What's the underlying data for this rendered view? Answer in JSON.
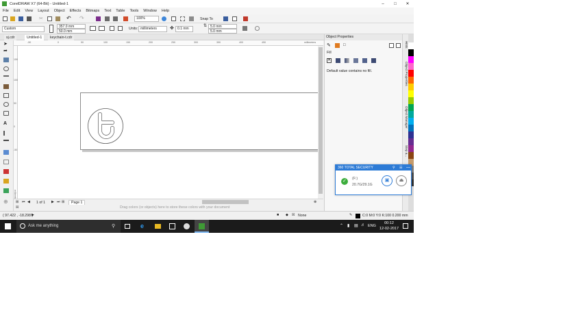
{
  "window": {
    "title": "CorelDRAW X7 (64-Bit) - Untitled-1",
    "controls": [
      "–",
      "□",
      "✕"
    ]
  },
  "menu": [
    "File",
    "Edit",
    "View",
    "Layout",
    "Object",
    "Effects",
    "Bitmaps",
    "Text",
    "Table",
    "Tools",
    "Window",
    "Help"
  ],
  "toolbar": {
    "zoom_value": "100%",
    "snap_to_label": "Snap To"
  },
  "property_bar": {
    "page_preset": "Custom",
    "page_width": "357.0 mm",
    "page_height": "50.0 mm",
    "units_label": "Units:",
    "units_value": "millimeters",
    "nudge": "0.1 mm",
    "dup_x": "5.0 mm",
    "dup_y": "5.0 mm"
  },
  "doc_tabs": [
    "sj.cdr",
    "Untitled-1",
    "keychain-t.cdr"
  ],
  "ruler": {
    "top_ticks": [
      "-50",
      "0",
      "50",
      "100",
      "150",
      "200",
      "250",
      "300",
      "350",
      "400",
      "450"
    ],
    "unit": "millimeters",
    "left_ticks": [
      "150",
      "100",
      "50",
      "0",
      "-50"
    ],
    "left_unit": "millimeters"
  },
  "page_nav": {
    "position": "1 of 1",
    "page_tab": "Page 1"
  },
  "palette_hint": "Drag colors (or objects) here to store these colors with your document",
  "status": {
    "coords": "( 97.422 , -18.298 )",
    "fill_label": "None",
    "outline_label": "C:0 M:0 Y:0 K:100  0.200 mm"
  },
  "docker": {
    "title": "Object Properties",
    "section": "Fill",
    "message": "Default value contains no fill.",
    "side_tabs": [
      "Hints",
      "Object Properties",
      "Object Manager",
      "Step a..."
    ]
  },
  "security_popup": {
    "title": "360 TOTAL SECURITY",
    "drive": "(F:)",
    "usage": "20.7G/29.1G"
  },
  "taskbar": {
    "search_placeholder": "Ask me anything",
    "lang": "ENG",
    "time": "00:12",
    "date": "12-02-2017"
  },
  "colors": {
    "accent": "#2d7bd6",
    "app_green": "#3f9a35",
    "taskbar": "#1b1b1b",
    "ok_green": "#3eae3e"
  },
  "palette_colors": [
    "#ffffff",
    "#000000",
    "#ff00ff",
    "#ff66cc",
    "#ff0000",
    "#ff6600",
    "#ffcc00",
    "#ffff00",
    "#99cc00",
    "#00a651",
    "#00a99d",
    "#00aeef",
    "#0072bc",
    "#2e3192",
    "#662d91",
    "#92278f",
    "#8b4513",
    "#c69c6d",
    "#808080",
    "#4d4d4d",
    "#333333"
  ]
}
